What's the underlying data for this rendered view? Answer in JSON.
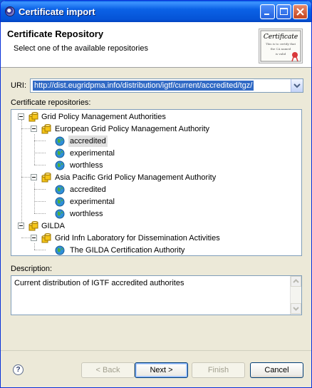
{
  "window": {
    "title": "Certificate import"
  },
  "banner": {
    "title": "Certificate Repository",
    "subtitle": "Select one of the available repositories",
    "image_lines": [
      "Certificate",
      "This is to certify that",
      "the CA named",
      "is valid"
    ]
  },
  "uri": {
    "label": "URI:",
    "value": "http://dist.eugridpma.info/distribution/igtf/current/accredited/tgz/"
  },
  "tree": {
    "label": "Certificate repositories:",
    "nodes": [
      {
        "label": "Grid Policy Management Authorities",
        "icon": "cylinder-folder-icon"
      },
      {
        "label": "European Grid Policy Management Authority",
        "icon": "cylinder-folder-icon"
      },
      {
        "label": "accredited",
        "icon": "globe-icon",
        "selected": true
      },
      {
        "label": "experimental",
        "icon": "globe-icon"
      },
      {
        "label": "worthless",
        "icon": "globe-icon"
      },
      {
        "label": "Asia Pacific Grid Policy Management Authority",
        "icon": "cylinder-folder-icon"
      },
      {
        "label": "accredited",
        "icon": "globe-icon"
      },
      {
        "label": "experimental",
        "icon": "globe-icon"
      },
      {
        "label": "worthless",
        "icon": "globe-icon"
      },
      {
        "label": "GILDA",
        "icon": "cylinder-folder-icon"
      },
      {
        "label": "Grid Infn Laboratory for Dissemination Activities",
        "icon": "cylinder-folder-icon"
      },
      {
        "label": "The GILDA Certification Authority",
        "icon": "globe-icon"
      }
    ]
  },
  "description": {
    "label": "Description:",
    "text": "Current distribution of IGTF accredited authorites"
  },
  "buttons": {
    "back": "< Back",
    "next": "Next >",
    "finish": "Finish",
    "cancel": "Cancel",
    "help": "?"
  },
  "colors": {
    "titlebar": "#0b62e6",
    "selection": "#316ac5",
    "folder_icon": "#f5c518",
    "globe_icon": "#2f8fd8"
  }
}
